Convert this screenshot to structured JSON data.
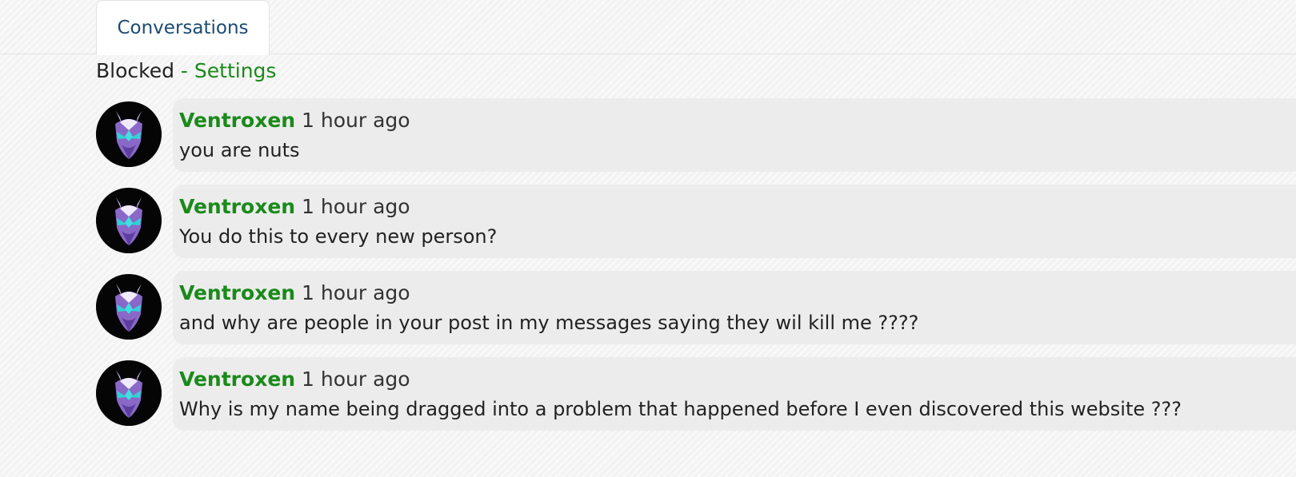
{
  "tabs": {
    "active_label": "Conversations"
  },
  "subheader": {
    "blocked_label": "Blocked",
    "separator": " - ",
    "settings_label": "Settings"
  },
  "messages": [
    {
      "author": "Ventroxen",
      "time": "1 hour ago",
      "text": "you are nuts"
    },
    {
      "author": "Ventroxen",
      "time": "1 hour ago",
      "text": "You do this to every new person?"
    },
    {
      "author": "Ventroxen",
      "time": "1 hour ago",
      "text": "and why are people in your post in my messages saying they wil kill me ????"
    },
    {
      "author": "Ventroxen",
      "time": "1 hour ago",
      "text": "Why is my name being dragged into a problem that happened before I even discovered this website ???"
    }
  ],
  "colors": {
    "link_green": "#1a8a1a",
    "tab_text_blue": "#1b4a73",
    "bubble_bg": "#ececec"
  },
  "icons": {
    "avatar": "purple-masked-warrior-avatar"
  }
}
